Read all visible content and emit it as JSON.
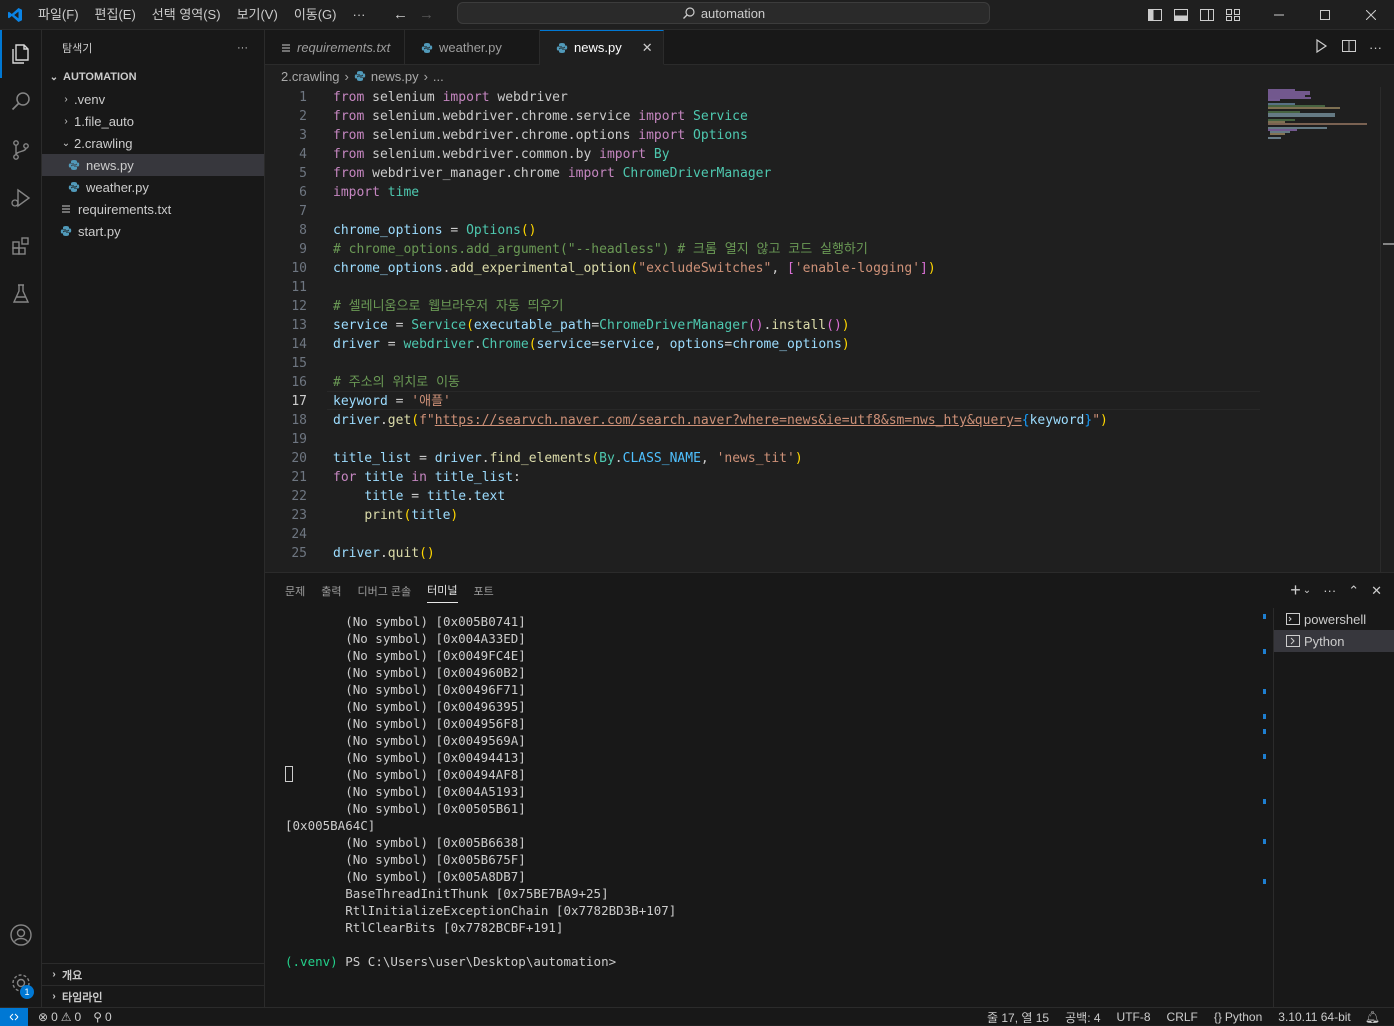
{
  "titlebar": {
    "menu": [
      "파일(F)",
      "편집(E)",
      "선택 영역(S)",
      "보기(V)",
      "이동(G)",
      "···"
    ],
    "search_text": "automation"
  },
  "sidebar": {
    "title": "탐색기",
    "root": "AUTOMATION",
    "items": [
      ".venv",
      "1.file_auto",
      "2.crawling",
      "news.py",
      "weather.py",
      "requirements.txt",
      "start.py"
    ],
    "sections": [
      "개요",
      "타임라인"
    ]
  },
  "tabs": [
    "requirements.txt",
    "weather.py",
    "news.py"
  ],
  "breadcrumb": [
    "2.crawling",
    "news.py",
    "..."
  ],
  "editor": {
    "line_numbers": [
      "1",
      "2",
      "3",
      "4",
      "5",
      "6",
      "7",
      "8",
      "9",
      "10",
      "11",
      "12",
      "13",
      "14",
      "15",
      "16",
      "17",
      "18",
      "19",
      "20",
      "21",
      "22",
      "23",
      "24",
      "25"
    ],
    "lines": [
      [
        "from",
        " selenium ",
        "import",
        " webdriver"
      ],
      [
        "from",
        " selenium.webdriver.chrome.service ",
        "import",
        " Service"
      ],
      [
        "from",
        " selenium.webdriver.chrome.options ",
        "import",
        " Options"
      ],
      [
        "from",
        " selenium.webdriver.common.by ",
        "import",
        " By"
      ],
      [
        "from",
        " webdriver_manager.chrome ",
        "import",
        " ChromeDriverManager"
      ],
      [
        "import",
        " time"
      ],
      [],
      [
        "chrome_options",
        " = ",
        "Options",
        "()"
      ],
      [
        "# chrome_options.add_argument(\"--headless\") # 크롬 열지 않고 코드 실행하기"
      ],
      [
        "chrome_options",
        ".",
        "add_experimental_option",
        "(",
        "\"excludeSwitches\"",
        ", ",
        "[",
        "'enable-logging'",
        "]",
        ")"
      ],
      [],
      [
        "# 셀레니움으로 웹브라우저 자동 띄우기"
      ],
      [
        "service",
        " = ",
        "Service",
        "(",
        "executable_path",
        "=",
        "ChromeDriverManager",
        "()",
        ".",
        "install",
        "()",
        ")"
      ],
      [
        "driver",
        " = ",
        "webdriver",
        ".",
        "Chrome",
        "(",
        "service",
        "=",
        "service",
        ", ",
        "options",
        "=",
        "chrome_options",
        ")"
      ],
      [],
      [
        "# 주소의 위치로 이동"
      ],
      [
        "keyword",
        " = ",
        "'애플'"
      ],
      [
        "driver",
        ".",
        "get",
        "(",
        "f\"",
        "https://searvch.naver.com/search.naver?where=news&ie=utf8&sm=nws_hty&query=",
        "{",
        "keyword",
        "}",
        "\"",
        ")"
      ],
      [],
      [
        "title_list",
        " = ",
        "driver",
        ".",
        "find_elements",
        "(",
        "By",
        ".",
        "CLASS_NAME",
        ", ",
        "'news_tit'",
        ")"
      ],
      [
        "for",
        " ",
        "title",
        " ",
        "in",
        " ",
        "title_list",
        ":"
      ],
      [
        "    ",
        "title",
        " = ",
        "title",
        ".",
        "text"
      ],
      [
        "    ",
        "print",
        "(",
        "title",
        ")"
      ],
      [],
      [
        "driver",
        ".",
        "quit",
        "()"
      ]
    ]
  },
  "panel": {
    "tabs": [
      "문제",
      "출력",
      "디버그 콘솔",
      "터미널",
      "포트"
    ],
    "terminal_lines": [
      "        (No symbol) [0x005B0741]",
      "        (No symbol) [0x004A33ED]",
      "        (No symbol) [0x0049FC4E]",
      "        (No symbol) [0x004960B2]",
      "        (No symbol) [0x00496F71]",
      "        (No symbol) [0x00496395]",
      "        (No symbol) [0x004956F8]",
      "        (No symbol) [0x0049569A]",
      "        (No symbol) [0x00494413]",
      "        (No symbol) [0x00494AF8]",
      "        (No symbol) [0x004A5193]",
      "        (No symbol) [0x00505B61]",
      "[0x005BA64C]",
      "        (No symbol) [0x005B6638]",
      "        (No symbol) [0x005B675F]",
      "        (No symbol) [0x005A8DB7]",
      "        BaseThreadInitThunk [0x75BE7BA9+25]",
      "        RtlInitializeExceptionChain [0x7782BD3B+107]",
      "        RtlClearBits [0x7782BCBF+191]",
      "",
      "(.venv) PS C:\\Users\\user\\Desktop\\automation>"
    ],
    "terminals": [
      "powershell",
      "Python"
    ]
  },
  "status": {
    "errors": "0",
    "warnings": "0",
    "ports": "0",
    "right": [
      "줄 17, 열 15",
      "공백: 4",
      "UTF-8",
      "CRLF",
      "Python",
      "3.10.11 64-bit"
    ],
    "badge": "1"
  },
  "colors": {
    "accent": "#0078d4",
    "background": "#1f1f1f",
    "sidebar": "#181818"
  }
}
